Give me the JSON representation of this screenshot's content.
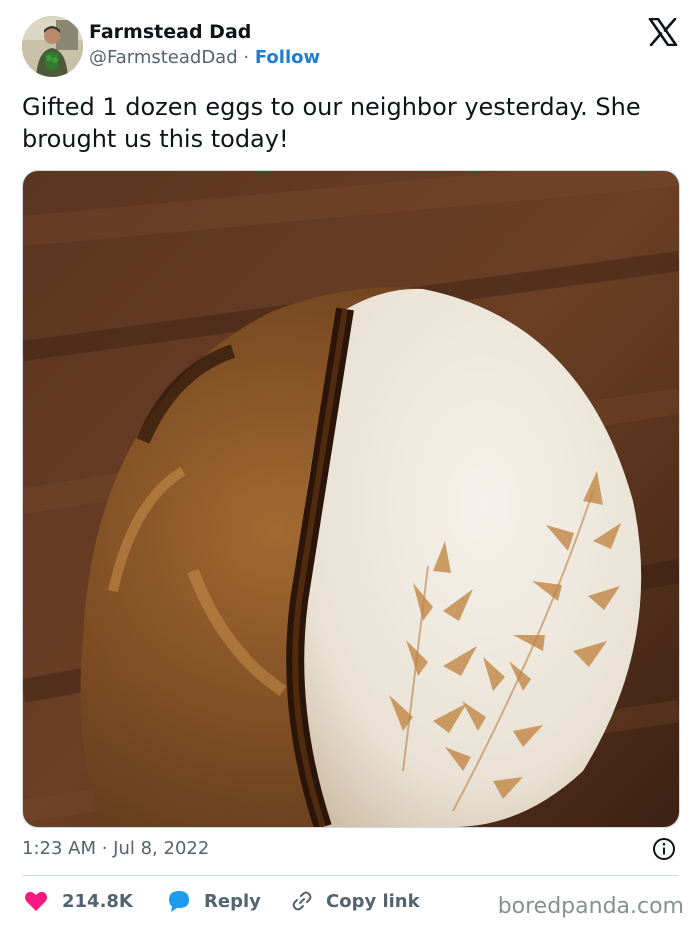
{
  "author": {
    "name": "Farmstead Dad",
    "handle": "@FarmsteadDad",
    "separator": "·",
    "follow_label": "Follow"
  },
  "tweet": {
    "text": "Gifted 1 dozen eggs to our neighbor yesterday. She brought us this today!",
    "timestamp": "1:23 AM · Jul 8, 2022"
  },
  "actions": {
    "likes_count": "214.8K",
    "reply_label": "Reply",
    "copy_link_label": "Copy link"
  },
  "watermark": "boredpanda.com",
  "colors": {
    "accent": "#1d9bf0",
    "heart": "#f91880",
    "muted": "#536471",
    "border": "#cfd9de"
  },
  "icons": {
    "logo": "x-logo-icon",
    "info": "info-icon",
    "like": "heart-icon",
    "reply": "speech-bubble-icon",
    "copy": "link-icon"
  }
}
